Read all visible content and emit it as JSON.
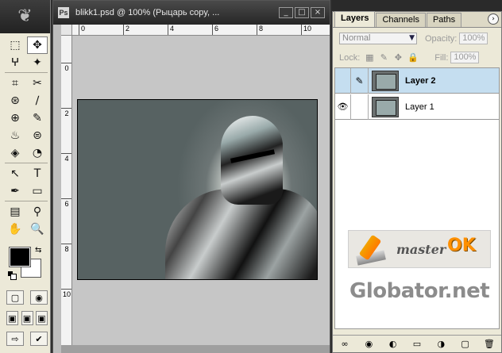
{
  "document": {
    "title": "blikk1.psd @ 100% (Рыцарь copy, ...",
    "icon_label": "Ps",
    "buttons": [
      "_",
      "□",
      "×"
    ],
    "ruler_h": [
      "0",
      "2",
      "4",
      "6",
      "8",
      "10"
    ],
    "ruler_v": [
      "0",
      "2",
      "4",
      "6",
      "8",
      "10"
    ]
  },
  "toolbox": {
    "tools": [
      "⬚",
      "✥",
      "ⵖ",
      "✦",
      "⌗",
      "✂",
      "⊛",
      "∕",
      "⊕",
      "✎",
      "♨",
      "⊜",
      "◈",
      "◔",
      "↖",
      "T",
      "✒",
      "▭",
      "▤",
      "⚲",
      "✋",
      "🔍"
    ],
    "swap_glyph": "⇆",
    "mask_buttons": [
      "▢",
      "◉"
    ],
    "screen_buttons": [
      "▣",
      "▣",
      "▣"
    ],
    "jump_buttons": [
      "⇨",
      "✔"
    ]
  },
  "layers_panel": {
    "tabs": [
      "Layers",
      "Channels",
      "Paths"
    ],
    "active_tab": "Layers",
    "menu_glyph": "›",
    "blend_mode": "Normal",
    "opacity_label": "Opacity:",
    "opacity_value": "100%",
    "lock_label": "Lock:",
    "lock_icons": [
      "▦",
      "✎",
      "✥",
      "🔒"
    ],
    "fill_label": "Fill:",
    "fill_value": "100%",
    "layers": [
      {
        "name": "Layer 2",
        "selected": true,
        "visible": false,
        "link_glyph": "✎",
        "eye_glyph": ""
      },
      {
        "name": "Layer 1",
        "selected": false,
        "visible": true,
        "link_glyph": "",
        "eye_glyph": "👁"
      }
    ],
    "bottom_icons": [
      "∞",
      "◉",
      "◐",
      "▭",
      "◑",
      "▢",
      "🗑"
    ]
  },
  "watermark": {
    "master": "master",
    "ok": "OK",
    "site": "Globator.net"
  }
}
